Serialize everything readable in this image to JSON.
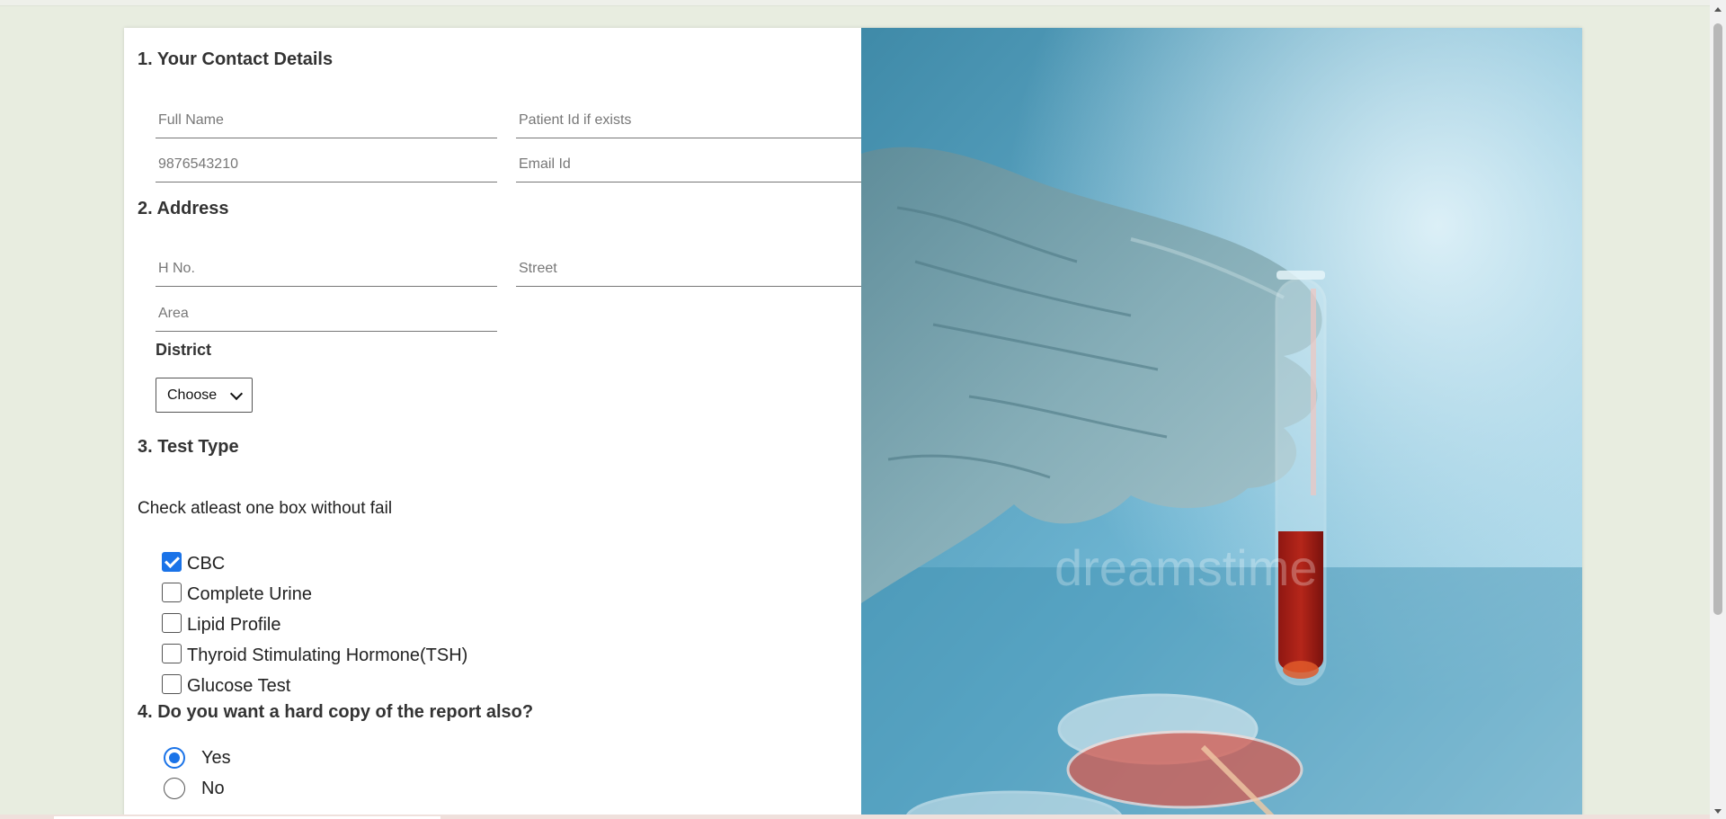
{
  "sections": {
    "contact": {
      "title": "1. Your Contact Details"
    },
    "address": {
      "title": "2. Address"
    },
    "test_type": {
      "title": "3. Test Type",
      "hint": "Check atleast one box without fail"
    },
    "hard_copy": {
      "title": "4. Do you want a hard copy of the report also?"
    }
  },
  "fields": {
    "full_name": {
      "placeholder": "Full Name",
      "value": ""
    },
    "patient_id": {
      "placeholder": "Patient Id if exists",
      "value": ""
    },
    "phone": {
      "placeholder": "9876543210",
      "value": ""
    },
    "email": {
      "placeholder": "Email Id",
      "value": ""
    },
    "house_no": {
      "placeholder": "H No.",
      "value": ""
    },
    "street": {
      "placeholder": "Street",
      "value": ""
    },
    "area": {
      "placeholder": "Area",
      "value": ""
    }
  },
  "district": {
    "label": "District",
    "selected": "Choose"
  },
  "tests": [
    {
      "label": "CBC",
      "checked": true
    },
    {
      "label": "Complete Urine",
      "checked": false
    },
    {
      "label": "Lipid Profile",
      "checked": false
    },
    {
      "label": "Thyroid Stimulating Hormone(TSH)",
      "checked": false
    },
    {
      "label": "Glucose Test",
      "checked": false
    }
  ],
  "hard_copy_options": [
    {
      "label": "Yes",
      "selected": true
    },
    {
      "label": "No",
      "selected": false
    }
  ],
  "image": {
    "watermark": "dreamstime"
  },
  "colors": {
    "accent": "#1a73e8",
    "page_bg": "#e8ede0",
    "photo_bg": "#5ba9c7"
  }
}
